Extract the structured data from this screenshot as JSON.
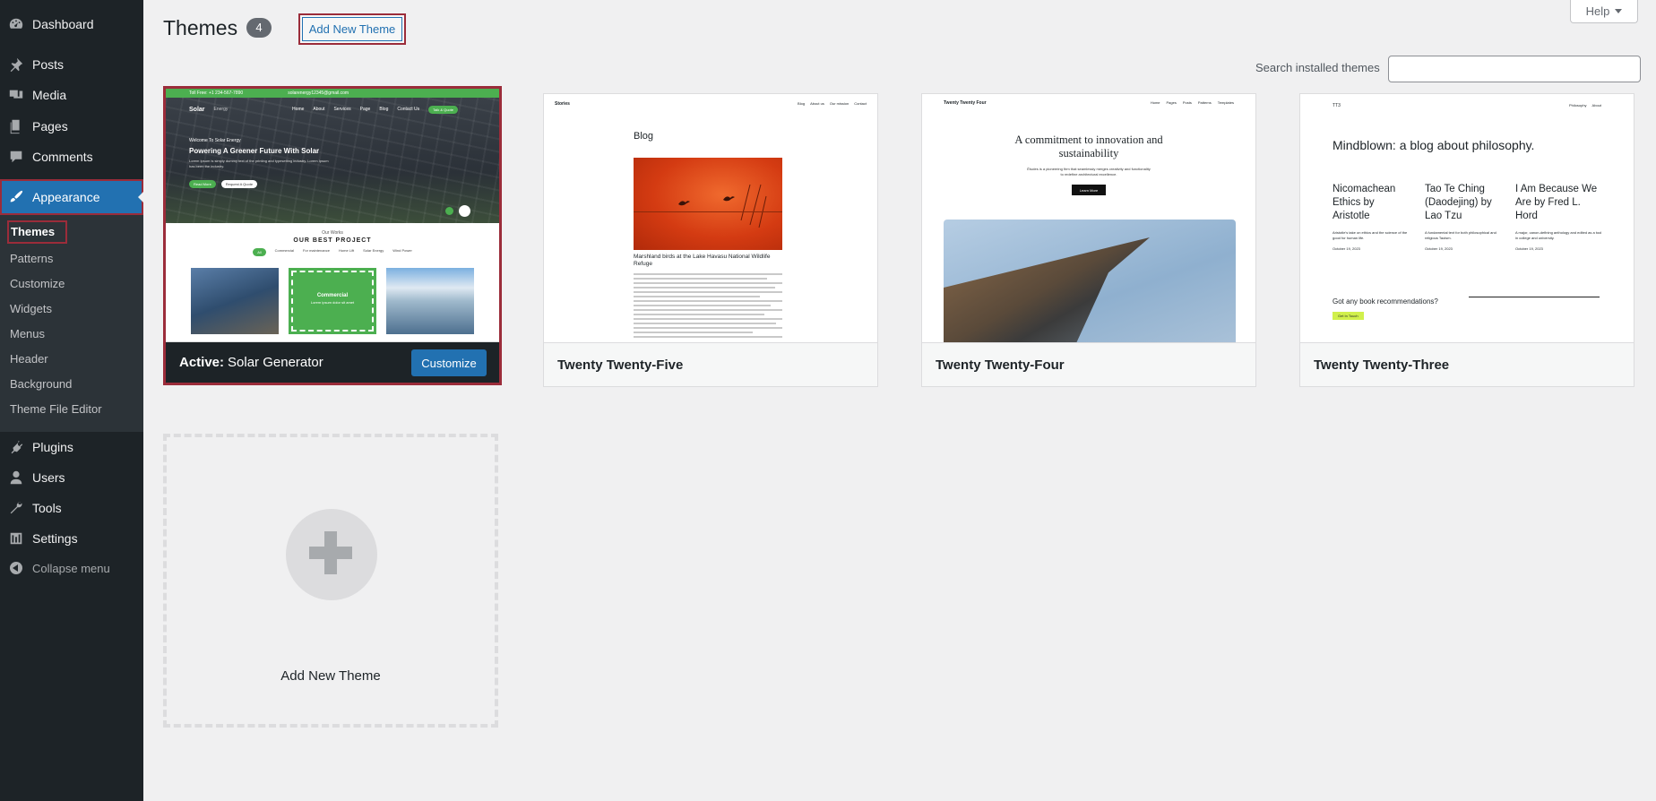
{
  "sidebar": {
    "items": [
      {
        "label": "Dashboard",
        "icon": "dashboard-icon"
      },
      {
        "label": "Posts",
        "icon": "pin-icon"
      },
      {
        "label": "Media",
        "icon": "media-icon"
      },
      {
        "label": "Pages",
        "icon": "pages-icon"
      },
      {
        "label": "Comments",
        "icon": "comment-icon"
      },
      {
        "label": "Appearance",
        "icon": "brush-icon",
        "active": true
      },
      {
        "label": "Plugins",
        "icon": "plugin-icon"
      },
      {
        "label": "Users",
        "icon": "user-icon"
      },
      {
        "label": "Tools",
        "icon": "wrench-icon"
      },
      {
        "label": "Settings",
        "icon": "settings-icon"
      },
      {
        "label": "Collapse menu",
        "icon": "collapse-icon"
      }
    ],
    "submenu": [
      "Themes",
      "Patterns",
      "Customize",
      "Widgets",
      "Menus",
      "Header",
      "Background",
      "Theme File Editor"
    ]
  },
  "header": {
    "title": "Themes",
    "count": "4",
    "add_new_label": "Add New Theme",
    "help_label": "Help"
  },
  "search": {
    "label": "Search installed themes",
    "placeholder": "",
    "value": ""
  },
  "themes": [
    {
      "name": "Solar Generator",
      "active_prefix": "Active:",
      "customize_label": "Customize"
    },
    {
      "name": "Twenty Twenty-Five"
    },
    {
      "name": "Twenty Twenty-Four"
    },
    {
      "name": "Twenty Twenty-Three"
    }
  ],
  "previews": {
    "solar": {
      "topbar_phone": "Toll Free: +1 234-567-7890",
      "topbar_email": "solarenergy12345@gmail.com",
      "logo": "Solar",
      "logo_sub": "Energy",
      "nav": [
        "Home",
        "About",
        "Services",
        "Page",
        "Blog",
        "Contact Us"
      ],
      "nav_cta": "Talk & Quote",
      "welcome": "Welcome To Solar Energy",
      "headline": "Powering A Greener Future With Solar",
      "body": "Lorem Ipsum is simply dummy text of the printing and typesetting industry. Lorem Ipsum has been the industry.",
      "btn_read": "Read More",
      "btn_quote": "Request A Quote",
      "works_kicker": "Our Works",
      "works_title": "OUR BEST PROJECT",
      "filters": [
        "All",
        "Commercial",
        "For maintenance",
        "Home Lift",
        "Solar Energy",
        "Wind Power"
      ],
      "tile_title": "Commercial",
      "tile_sub": "Lorem ipsum dolor sit amet"
    },
    "tt5": {
      "site": "Stories",
      "nav": [
        "Blog",
        "About us",
        "Our mission",
        "Contact"
      ],
      "heading": "Blog",
      "caption": "Marshland birds at the Lake Havasu National Wildlife Refuge"
    },
    "tt4": {
      "site": "Twenty Twenty Four",
      "nav": [
        "Home",
        "Pages",
        "Posts",
        "Patterns",
        "Templates"
      ],
      "headline": "A commitment to innovation and sustainability",
      "body": "Études is a pioneering firm that seamlessly merges creativity and functionality to redefine architectural excellence.",
      "button": "Learn More"
    },
    "tt3": {
      "site": "TT3",
      "nav": [
        "Philosophy",
        "About"
      ],
      "headline": "Mindblown: a blog about philosophy.",
      "posts": [
        {
          "title": "Nicomachean Ethics by Aristotle",
          "excerpt": "Aristotle's take on ethics and the science of the good for human life.",
          "date": "October 19, 2023"
        },
        {
          "title": "Tao Te Ching (Daodejing) by Lao Tzu",
          "excerpt": "A fundamental text for both philosophical and religious Taoism.",
          "date": "October 19, 2023"
        },
        {
          "title": "I Am Because We Are by Fred L. Hord",
          "excerpt": "A major, canon-defining anthology and edited as a tool in college and university.",
          "date": "October 19, 2023"
        }
      ],
      "cta_text": "Got any book recommendations?",
      "cta_button": "Get In Touch"
    }
  },
  "add_tile": {
    "label": "Add New Theme"
  },
  "colors": {
    "sidebar_bg": "#1d2327",
    "accent": "#2271b1",
    "highlight": "#9b2c3a",
    "content_bg": "#f0f0f1"
  }
}
